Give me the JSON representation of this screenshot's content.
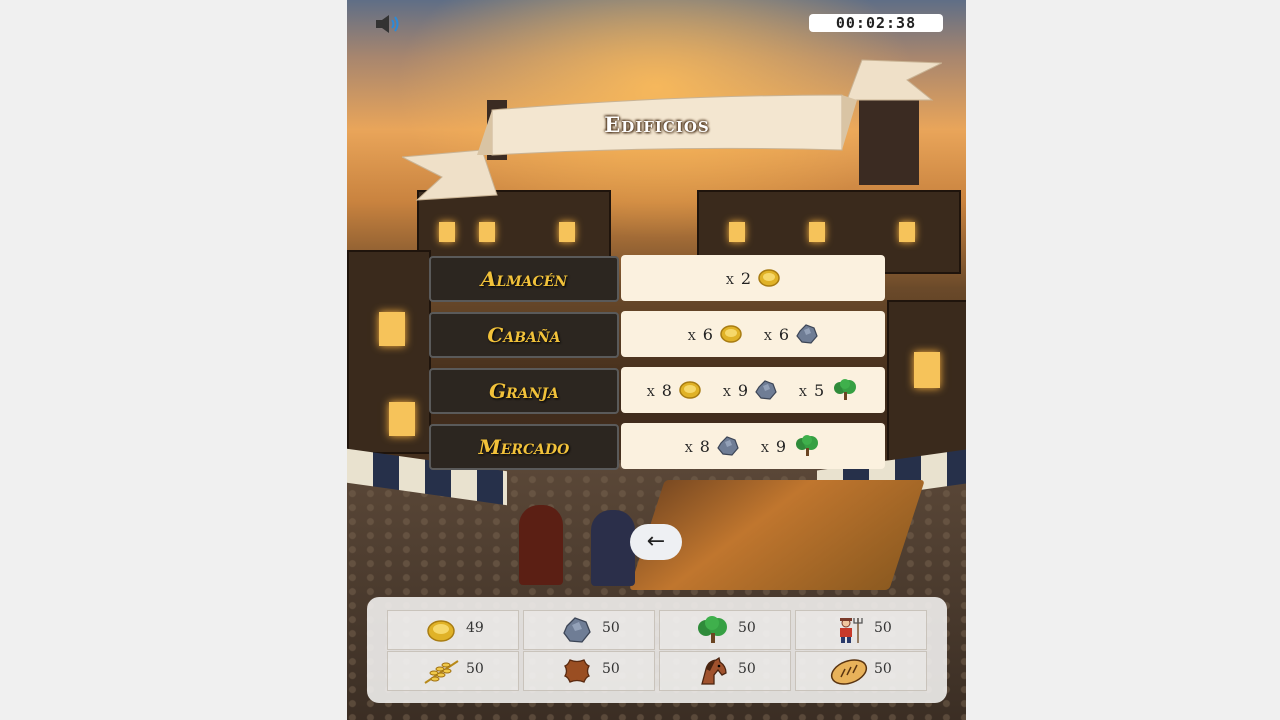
{
  "timer": "00:02:38",
  "banner_title": "Edificios",
  "buildings": [
    {
      "name": "Almacén",
      "costs": [
        {
          "qty": "x 2",
          "resource": "gold"
        }
      ]
    },
    {
      "name": "Cabaña",
      "costs": [
        {
          "qty": "x 6",
          "resource": "gold"
        },
        {
          "qty": "x 6",
          "resource": "stone"
        }
      ]
    },
    {
      "name": "Granja",
      "costs": [
        {
          "qty": "x 8",
          "resource": "gold"
        },
        {
          "qty": "x 9",
          "resource": "stone"
        },
        {
          "qty": "x 5",
          "resource": "wood"
        }
      ]
    },
    {
      "name": "Mercado",
      "costs": [
        {
          "qty": "x 8",
          "resource": "stone"
        },
        {
          "qty": "x 9",
          "resource": "wood"
        }
      ]
    }
  ],
  "back_label": "←",
  "resources": [
    {
      "resource": "gold",
      "value": "49"
    },
    {
      "resource": "stone",
      "value": "50"
    },
    {
      "resource": "wood",
      "value": "50"
    },
    {
      "resource": "worker",
      "value": "50"
    },
    {
      "resource": "wheat",
      "value": "50"
    },
    {
      "resource": "leather",
      "value": "50"
    },
    {
      "resource": "horse",
      "value": "50"
    },
    {
      "resource": "bread",
      "value": "50"
    }
  ],
  "icons": {
    "sound": "speaker-icon",
    "gold": "gold-coin-icon",
    "stone": "stone-icon",
    "wood": "tree-icon",
    "worker": "farmer-icon",
    "wheat": "wheat-icon",
    "leather": "leather-hide-icon",
    "horse": "horse-icon",
    "bread": "bread-icon"
  },
  "colors": {
    "building_label": "#f2c23a",
    "building_label_bg": "#2c2620",
    "cost_bg": "#fbf1df"
  }
}
